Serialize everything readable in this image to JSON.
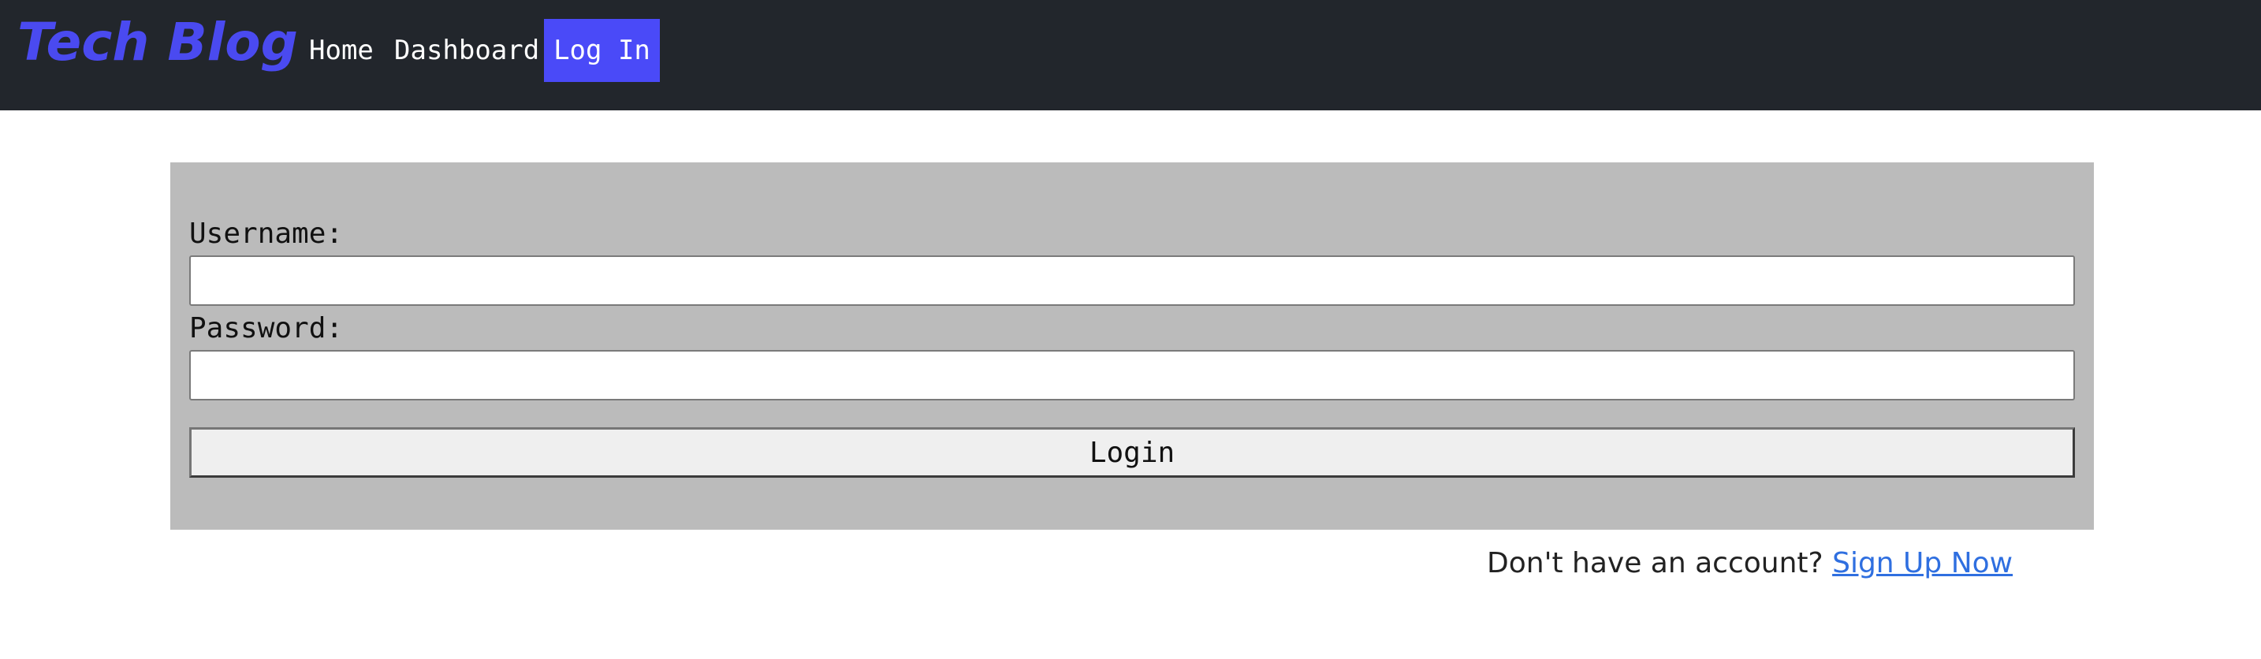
{
  "navbar": {
    "brand": "Tech Blog",
    "links": [
      {
        "label": "Home"
      },
      {
        "label": "Dashboard"
      },
      {
        "label": "Log In",
        "active": true
      }
    ],
    "background_color": "#22262c",
    "brand_color": "#4a4af0",
    "active_color": "#4a4af8"
  },
  "login_form": {
    "username_label": "Username:",
    "username_value": "",
    "password_label": "Password:",
    "password_value": "",
    "submit_label": "Login",
    "background_color": "#bbbbbb"
  },
  "signup": {
    "prompt": "Don't have an account?",
    "link_label": "Sign Up Now",
    "link_color": "#2f6fe0"
  }
}
